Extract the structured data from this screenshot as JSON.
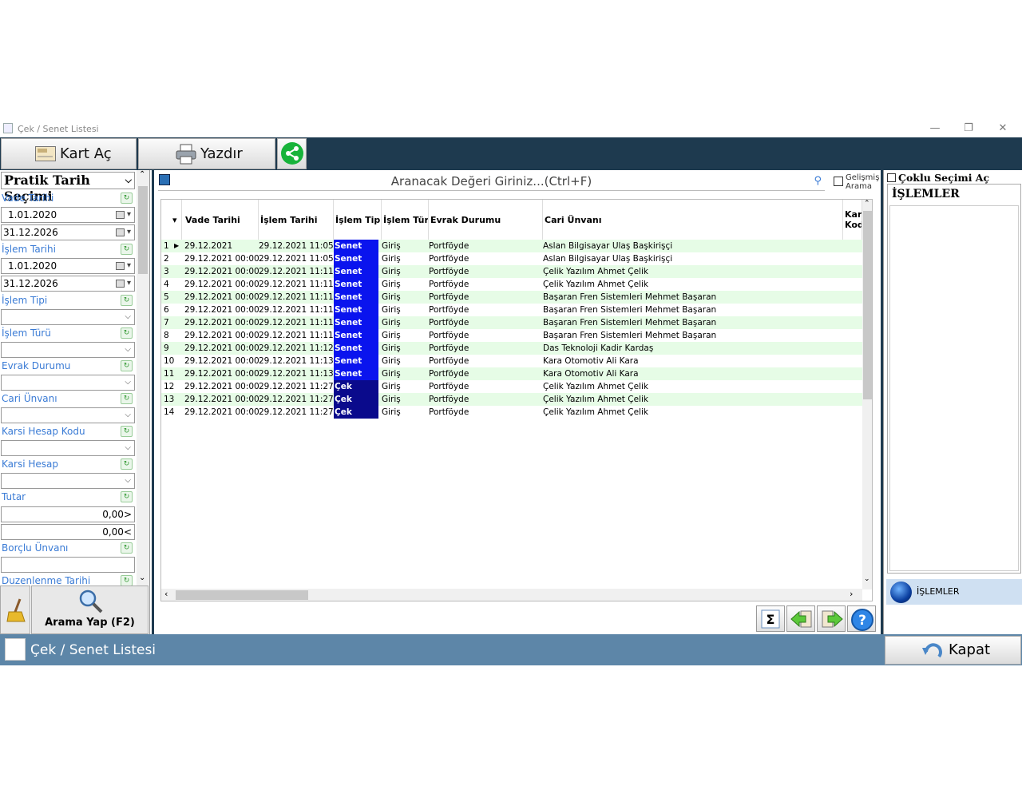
{
  "window": {
    "title": "Çek / Senet Listesi",
    "minimize": "—",
    "restore": "❐",
    "close": "✕"
  },
  "toolbar": {
    "kart_ac": "Kart Aç",
    "yazdir": "Yazdır",
    "kart_ac_icon_text": "CHECK"
  },
  "left_panel": {
    "header": "Pratik Tarih Seçimi",
    "vade_tarihi_label": "Vade Tarihi",
    "vade_from": "1.01.2020",
    "vade_to": "31.12.2026",
    "islem_tarihi_label": "İşlem Tarihi",
    "islem_from": "1.01.2020",
    "islem_to": "31.12.2026",
    "islem_tipi_label": "İşlem Tipi",
    "islem_turu_label": "İşlem Türü",
    "evrak_durumu_label": "Evrak Durumu",
    "cari_unvani_label": "Cari Ünvanı",
    "karsi_hesap_kodu_label": "Karsi Hesap Kodu",
    "karsi_hesap_label": "Karsi Hesap",
    "tutar_label": "Tutar",
    "tutar_min": "0,00>",
    "tutar_max": "0,00<",
    "borclu_unvani_label": "Borçlu Ünvanı",
    "duzenlenme_tarihi_label": "Duzenlenme Tarihi",
    "search_button": "Arama Yap (F2)"
  },
  "search": {
    "placeholder": "Aranacak Değeri Giriniz...(Ctrl+F)",
    "advanced_line1": "Gelişmiş",
    "advanced_line2": "Arama"
  },
  "grid": {
    "columns": [
      "Vade Tarihi",
      "İşlem Tarihi",
      "İşlem Tipi",
      "İşlem Türü",
      "Evrak Durumu",
      "Cari Ünvanı",
      "Karsi Kodu"
    ],
    "rows": [
      [
        "1",
        "29.12.2021",
        "29.12.2021 11:05",
        "Senet",
        "Giriş",
        "Portföyde",
        "Aslan Bilgisayar Ulaş Başkirişçi"
      ],
      [
        "2",
        "29.12.2021 00:00",
        "29.12.2021 11:05",
        "Senet",
        "Giriş",
        "Portföyde",
        "Aslan Bilgisayar Ulaş Başkirişçi"
      ],
      [
        "3",
        "29.12.2021 00:00",
        "29.12.2021 11:11",
        "Senet",
        "Giriş",
        "Portföyde",
        "Çelik Yazılım Ahmet Çelik"
      ],
      [
        "4",
        "29.12.2021 00:00",
        "29.12.2021 11:11",
        "Senet",
        "Giriş",
        "Portföyde",
        "Çelik Yazılım Ahmet Çelik"
      ],
      [
        "5",
        "29.12.2021 00:00",
        "29.12.2021 11:11",
        "Senet",
        "Giriş",
        "Portföyde",
        "Başaran Fren Sistemleri Mehmet Başaran"
      ],
      [
        "6",
        "29.12.2021 00:00",
        "29.12.2021 11:11",
        "Senet",
        "Giriş",
        "Portföyde",
        "Başaran Fren Sistemleri Mehmet Başaran"
      ],
      [
        "7",
        "29.12.2021 00:00",
        "29.12.2021 11:11",
        "Senet",
        "Giriş",
        "Portföyde",
        "Başaran Fren Sistemleri Mehmet Başaran"
      ],
      [
        "8",
        "29.12.2021 00:00",
        "29.12.2021 11:11",
        "Senet",
        "Giriş",
        "Portföyde",
        "Başaran Fren Sistemleri Mehmet Başaran"
      ],
      [
        "9",
        "29.12.2021 00:00",
        "29.12.2021 11:12",
        "Senet",
        "Giriş",
        "Portföyde",
        "Das Teknoloji Kadir Kardaş"
      ],
      [
        "10",
        "29.12.2021 00:00",
        "29.12.2021 11:13",
        "Senet",
        "Giriş",
        "Portföyde",
        "Kara Otomotiv Ali Kara"
      ],
      [
        "11",
        "29.12.2021 00:00",
        "29.12.2021 11:13",
        "Senet",
        "Giriş",
        "Portföyde",
        "Kara Otomotiv Ali Kara"
      ],
      [
        "12",
        "29.12.2021 00:00",
        "29.12.2021 11:27",
        "Çek",
        "Giriş",
        "Portföyde",
        "Çelik Yazılım Ahmet Çelik"
      ],
      [
        "13",
        "29.12.2021 00:00",
        "29.12.2021 11:27",
        "Çek",
        "Giriş",
        "Portföyde",
        "Çelik Yazılım Ahmet Çelik"
      ],
      [
        "14",
        "29.12.2021 00:00",
        "29.12.2021 11:27",
        "Çek",
        "Giriş",
        "Portföyde",
        "Çelik Yazılım Ahmet Çelik"
      ]
    ],
    "type_colors": {
      "Senet": "#0a14ee",
      "Çek": "#0a0a8c"
    }
  },
  "right_panel": {
    "coklu_secimi": "Çoklu Seçimi Aç",
    "title": "İŞLEMLER",
    "item": "İŞLEMLER"
  },
  "status": {
    "title": "Çek / Senet Listesi",
    "kapat": "Kapat"
  },
  "colors": {
    "toolbar_bg": "#1e3a4f",
    "status_bg": "#5d86a8",
    "row_alt": "#e6fce6",
    "label_blue": "#3a7bd5"
  }
}
